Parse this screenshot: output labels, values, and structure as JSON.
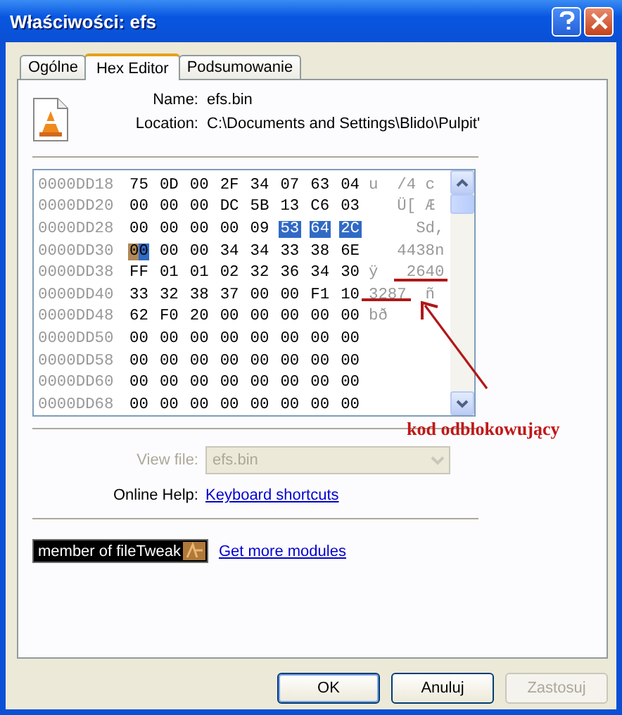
{
  "window": {
    "title": "Właściwości: efs"
  },
  "tabs": [
    {
      "label": "Ogólne",
      "selected": false
    },
    {
      "label": "Hex Editor",
      "selected": true
    },
    {
      "label": "Podsumowanie",
      "selected": false
    }
  ],
  "file_info": {
    "name_label": "Name:",
    "name": "efs.bin",
    "location_label": "Location:",
    "location": "C:\\Documents and Settings\\Blido\\Pulpit'"
  },
  "hex_view": {
    "rows": [
      {
        "address": "0000DD18",
        "bytes": [
          {
            "value": "75",
            "selected": false,
            "cursor": false
          },
          {
            "value": "0D",
            "selected": false,
            "cursor": false
          },
          {
            "value": "00",
            "selected": false,
            "cursor": false
          },
          {
            "value": "2F",
            "selected": false,
            "cursor": false
          },
          {
            "value": "34",
            "selected": false,
            "cursor": false
          },
          {
            "value": "07",
            "selected": false,
            "cursor": false
          },
          {
            "value": "63",
            "selected": false,
            "cursor": false
          },
          {
            "value": "04",
            "selected": false,
            "cursor": false
          }
        ],
        "ascii": "u  /4 c"
      },
      {
        "address": "0000DD20",
        "bytes": [
          {
            "value": "00",
            "selected": false,
            "cursor": false
          },
          {
            "value": "00",
            "selected": false,
            "cursor": false
          },
          {
            "value": "00",
            "selected": false,
            "cursor": false
          },
          {
            "value": "DC",
            "selected": false,
            "cursor": false
          },
          {
            "value": "5B",
            "selected": false,
            "cursor": false
          },
          {
            "value": "13",
            "selected": false,
            "cursor": false
          },
          {
            "value": "C6",
            "selected": false,
            "cursor": false
          },
          {
            "value": "03",
            "selected": false,
            "cursor": false
          }
        ],
        "ascii": "   Ü[ Æ"
      },
      {
        "address": "0000DD28",
        "bytes": [
          {
            "value": "00",
            "selected": false,
            "cursor": false
          },
          {
            "value": "00",
            "selected": false,
            "cursor": false
          },
          {
            "value": "00",
            "selected": false,
            "cursor": false
          },
          {
            "value": "00",
            "selected": false,
            "cursor": false
          },
          {
            "value": "09",
            "selected": false,
            "cursor": false
          },
          {
            "value": "53",
            "selected": true,
            "cursor": false
          },
          {
            "value": "64",
            "selected": true,
            "cursor": false
          },
          {
            "value": "2C",
            "selected": true,
            "cursor": false
          }
        ],
        "ascii": "     Sd,"
      },
      {
        "address": "0000DD30",
        "bytes": [
          {
            "value": "00",
            "selected": true,
            "cursor": true
          },
          {
            "value": "00",
            "selected": false,
            "cursor": false
          },
          {
            "value": "00",
            "selected": false,
            "cursor": false
          },
          {
            "value": "34",
            "selected": false,
            "cursor": false
          },
          {
            "value": "34",
            "selected": false,
            "cursor": false
          },
          {
            "value": "33",
            "selected": false,
            "cursor": false
          },
          {
            "value": "38",
            "selected": false,
            "cursor": false
          },
          {
            "value": "6E",
            "selected": false,
            "cursor": false
          }
        ],
        "ascii": "   4438n"
      },
      {
        "address": "0000DD38",
        "bytes": [
          {
            "value": "FF",
            "selected": false,
            "cursor": false
          },
          {
            "value": "01",
            "selected": false,
            "cursor": false
          },
          {
            "value": "01",
            "selected": false,
            "cursor": false
          },
          {
            "value": "02",
            "selected": false,
            "cursor": false
          },
          {
            "value": "32",
            "selected": false,
            "cursor": false
          },
          {
            "value": "36",
            "selected": false,
            "cursor": false
          },
          {
            "value": "34",
            "selected": false,
            "cursor": false
          },
          {
            "value": "30",
            "selected": false,
            "cursor": false
          }
        ],
        "ascii": "ÿ   2640"
      },
      {
        "address": "0000DD40",
        "bytes": [
          {
            "value": "33",
            "selected": false,
            "cursor": false
          },
          {
            "value": "32",
            "selected": false,
            "cursor": false
          },
          {
            "value": "38",
            "selected": false,
            "cursor": false
          },
          {
            "value": "37",
            "selected": false,
            "cursor": false
          },
          {
            "value": "00",
            "selected": false,
            "cursor": false
          },
          {
            "value": "00",
            "selected": false,
            "cursor": false
          },
          {
            "value": "F1",
            "selected": false,
            "cursor": false
          },
          {
            "value": "10",
            "selected": false,
            "cursor": false
          }
        ],
        "ascii": "3287  ñ"
      },
      {
        "address": "0000DD48",
        "bytes": [
          {
            "value": "62",
            "selected": false,
            "cursor": false
          },
          {
            "value": "F0",
            "selected": false,
            "cursor": false
          },
          {
            "value": "20",
            "selected": false,
            "cursor": false
          },
          {
            "value": "00",
            "selected": false,
            "cursor": false
          },
          {
            "value": "00",
            "selected": false,
            "cursor": false
          },
          {
            "value": "00",
            "selected": false,
            "cursor": false
          },
          {
            "value": "00",
            "selected": false,
            "cursor": false
          },
          {
            "value": "00",
            "selected": false,
            "cursor": false
          }
        ],
        "ascii": "bð"
      },
      {
        "address": "0000DD50",
        "bytes": [
          {
            "value": "00",
            "selected": false,
            "cursor": false
          },
          {
            "value": "00",
            "selected": false,
            "cursor": false
          },
          {
            "value": "00",
            "selected": false,
            "cursor": false
          },
          {
            "value": "00",
            "selected": false,
            "cursor": false
          },
          {
            "value": "00",
            "selected": false,
            "cursor": false
          },
          {
            "value": "00",
            "selected": false,
            "cursor": false
          },
          {
            "value": "00",
            "selected": false,
            "cursor": false
          },
          {
            "value": "00",
            "selected": false,
            "cursor": false
          }
        ]
      },
      {
        "address": "0000DD58",
        "bytes": [
          {
            "value": "00",
            "selected": false,
            "cursor": false
          },
          {
            "value": "00",
            "selected": false,
            "cursor": false
          },
          {
            "value": "00",
            "selected": false,
            "cursor": false
          },
          {
            "value": "00",
            "selected": false,
            "cursor": false
          },
          {
            "value": "00",
            "selected": false,
            "cursor": false
          },
          {
            "value": "00",
            "selected": false,
            "cursor": false
          },
          {
            "value": "00",
            "selected": false,
            "cursor": false
          },
          {
            "value": "00",
            "selected": false,
            "cursor": false
          }
        ]
      },
      {
        "address": "0000DD60",
        "bytes": [
          {
            "value": "00",
            "selected": false,
            "cursor": false
          },
          {
            "value": "00",
            "selected": false,
            "cursor": false
          },
          {
            "value": "00",
            "selected": false,
            "cursor": false
          },
          {
            "value": "00",
            "selected": false,
            "cursor": false
          },
          {
            "value": "00",
            "selected": false,
            "cursor": false
          },
          {
            "value": "00",
            "selected": false,
            "cursor": false
          },
          {
            "value": "00",
            "selected": false,
            "cursor": false
          },
          {
            "value": "00",
            "selected": false,
            "cursor": false
          }
        ]
      },
      {
        "address": "0000DD68",
        "bytes": [
          {
            "value": "00",
            "selected": false,
            "cursor": false
          },
          {
            "value": "00",
            "selected": false,
            "cursor": false
          },
          {
            "value": "00",
            "selected": false,
            "cursor": false
          },
          {
            "value": "00",
            "selected": false,
            "cursor": false
          },
          {
            "value": "00",
            "selected": false,
            "cursor": false
          },
          {
            "value": "00",
            "selected": false,
            "cursor": false
          },
          {
            "value": "00",
            "selected": false,
            "cursor": false
          },
          {
            "value": "00",
            "selected": false,
            "cursor": false
          }
        ]
      }
    ]
  },
  "annotation": {
    "text": "kod odblokowujący"
  },
  "view_file": {
    "label": "View file:",
    "value": "efs.bin",
    "disabled": true
  },
  "online_help": {
    "label": "Online Help:",
    "link": "Keyboard shortcuts"
  },
  "badge": {
    "text": "member of fileTweak"
  },
  "more_modules_link": "Get more modules",
  "buttons": [
    {
      "label": "OK",
      "disabled": false,
      "default": true
    },
    {
      "label": "Anuluj",
      "disabled": false,
      "default": false
    },
    {
      "label": "Zastosuj",
      "disabled": true,
      "default": false
    }
  ]
}
